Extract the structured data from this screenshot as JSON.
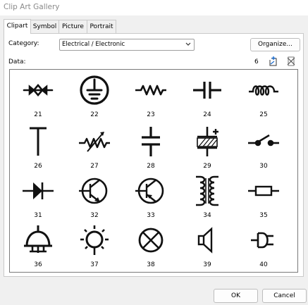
{
  "window": {
    "title": "Clip Art Gallery"
  },
  "tabs": [
    "Clipart",
    "Symbol",
    "Picture",
    "Portrait"
  ],
  "category": {
    "label": "Category:",
    "value": "Electrical / Electronic"
  },
  "organize_label": "Organize...",
  "data_label": "Data:",
  "count": "6",
  "items": [
    {
      "num": "21",
      "icon": "diode-pair-symbol-icon"
    },
    {
      "num": "22",
      "icon": "ground-symbol-icon"
    },
    {
      "num": "23",
      "icon": "resistor-symbol-icon"
    },
    {
      "num": "24",
      "icon": "capacitor-symbol-icon"
    },
    {
      "num": "25",
      "icon": "inductor-symbol-icon"
    },
    {
      "num": "26",
      "icon": "t-junction-symbol-icon"
    },
    {
      "num": "27",
      "icon": "variable-resistor-symbol-icon"
    },
    {
      "num": "28",
      "icon": "capacitor-vertical-symbol-icon"
    },
    {
      "num": "29",
      "icon": "battery-symbol-icon"
    },
    {
      "num": "30",
      "icon": "switch-symbol-icon"
    },
    {
      "num": "31",
      "icon": "diode-symbol-icon"
    },
    {
      "num": "32",
      "icon": "npn-transistor-symbol-icon"
    },
    {
      "num": "33",
      "icon": "pnp-transistor-symbol-icon"
    },
    {
      "num": "34",
      "icon": "transformer-symbol-icon"
    },
    {
      "num": "35",
      "icon": "fuse-symbol-icon"
    },
    {
      "num": "36",
      "icon": "bell-symbol-icon"
    },
    {
      "num": "37",
      "icon": "lamp-symbol-icon"
    },
    {
      "num": "38",
      "icon": "indicator-lamp-symbol-icon"
    },
    {
      "num": "39",
      "icon": "speaker-symbol-icon"
    },
    {
      "num": "40",
      "icon": "plug-symbol-icon"
    }
  ],
  "buttons": {
    "ok": "OK",
    "cancel": "Cancel"
  }
}
